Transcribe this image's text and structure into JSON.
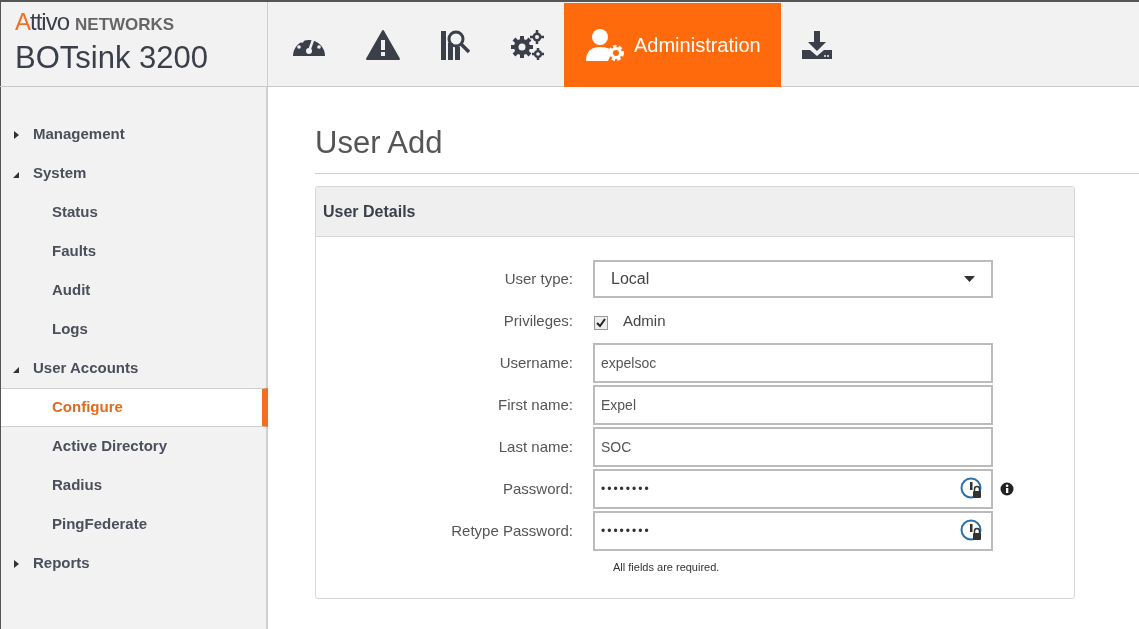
{
  "brand": {
    "company": "Attivo",
    "company_suffix": "NETWORKS",
    "product": "BOTsink 3200"
  },
  "nav_tabs": [
    {
      "kind": "dashboard",
      "selected": false
    },
    {
      "kind": "alerts",
      "selected": false
    },
    {
      "kind": "analysis",
      "selected": false
    },
    {
      "kind": "settings",
      "selected": false
    },
    {
      "kind": "administration",
      "label": "Administration",
      "selected": true
    },
    {
      "kind": "download",
      "selected": false
    }
  ],
  "sidebar": {
    "items": [
      {
        "label": "Management",
        "expanded": false,
        "selected": false
      },
      {
        "label": "System",
        "expanded": true,
        "selected": false,
        "children": [
          {
            "label": "Status",
            "selected": false
          },
          {
            "label": "Faults",
            "selected": false
          },
          {
            "label": "Audit",
            "selected": false
          },
          {
            "label": "Logs",
            "selected": false
          }
        ]
      },
      {
        "label": "User Accounts",
        "expanded": true,
        "selected": false,
        "children": [
          {
            "label": "Configure",
            "selected": true
          },
          {
            "label": "Active Directory",
            "selected": false
          },
          {
            "label": "Radius",
            "selected": false
          },
          {
            "label": "PingFederate",
            "selected": false
          }
        ]
      },
      {
        "label": "Reports",
        "expanded": false,
        "selected": false
      }
    ]
  },
  "page_title": "User Add",
  "panel": {
    "title": "User Details",
    "fields": [
      {
        "kind": "select",
        "label": "User type:",
        "value": "Local"
      },
      {
        "kind": "checkbox",
        "label": "Privileges:",
        "option": "Admin",
        "checked": true
      },
      {
        "kind": "text",
        "label": "Username:",
        "value": "expelsoc"
      },
      {
        "kind": "text",
        "label": "First name:",
        "value": "Expel"
      },
      {
        "kind": "text",
        "label": "Last name:",
        "value": "SOC"
      },
      {
        "kind": "password",
        "label": "Password:",
        "value": "••••••••",
        "info": true
      },
      {
        "kind": "password",
        "label": "Retype Password:",
        "value": "••••••••",
        "info": false
      }
    ],
    "note": "All fields are required."
  }
}
